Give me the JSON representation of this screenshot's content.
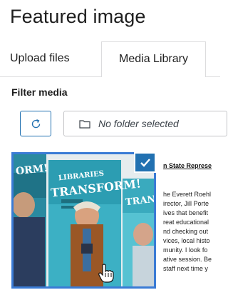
{
  "panel": {
    "title": "Featured image"
  },
  "tabs": [
    {
      "label": "Upload files"
    },
    {
      "label": "Media Library"
    }
  ],
  "filter": {
    "label": "Filter media",
    "folder_value": "No folder selected"
  },
  "media": {
    "items": [
      {
        "poster_text_1": "LIBRARIES",
        "poster_text_2": "TRANSFORM!",
        "poster_left_text": "ORM!",
        "poster_right_text": "TRAN",
        "selected": true
      },
      {
        "heading": "n State Represe",
        "lines": [
          "he Everett Roehl",
          "irector, Jill Porte",
          "ives that benefit",
          "reat educational",
          "nd checking out",
          "vices, local histo",
          "munity. I look fo",
          "ative session. Be",
          "staff next time y"
        ]
      }
    ]
  },
  "colors": {
    "accent": "#2271b1",
    "selection_border": "#3a7bd5"
  }
}
